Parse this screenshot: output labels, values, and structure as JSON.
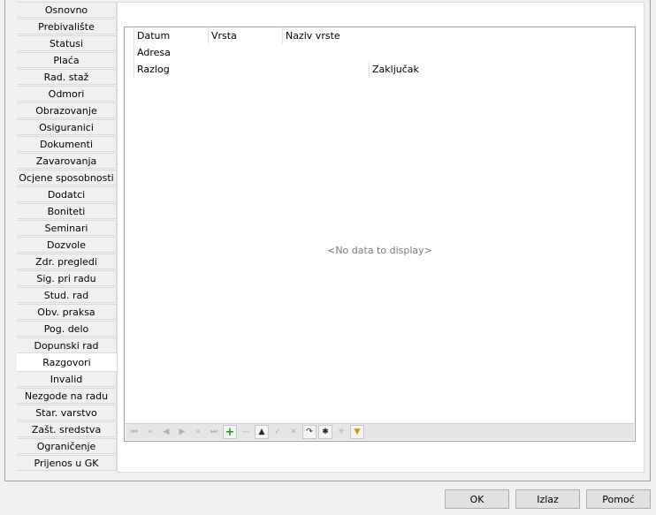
{
  "tabs": [
    {
      "label": "Osnovno"
    },
    {
      "label": "Prebivalište"
    },
    {
      "label": "Statusi"
    },
    {
      "label": "Plaća"
    },
    {
      "label": "Rad. staž"
    },
    {
      "label": "Odmori"
    },
    {
      "label": "Obrazovanje"
    },
    {
      "label": "Osiguranici"
    },
    {
      "label": "Dokumenti"
    },
    {
      "label": "Zavarovanja"
    },
    {
      "label": "Ocjene sposobnosti"
    },
    {
      "label": "Dodatci"
    },
    {
      "label": "Boniteti"
    },
    {
      "label": "Seminari"
    },
    {
      "label": "Dozvole"
    },
    {
      "label": "Zdr. pregledi"
    },
    {
      "label": "Sig. pri radu"
    },
    {
      "label": "Stud. rad"
    },
    {
      "label": "Obv. praksa"
    },
    {
      "label": "Pog. delo"
    },
    {
      "label": "Dopunski rad"
    },
    {
      "label": "Razgovori"
    },
    {
      "label": "Invalid"
    },
    {
      "label": "Nezgode na radu"
    },
    {
      "label": "Star. varstvo"
    },
    {
      "label": "Zašt. sredstva"
    },
    {
      "label": "Ograničenje"
    },
    {
      "label": "Prijenos u GK"
    }
  ],
  "active_tab": "Razgovori",
  "grid": {
    "header_row1": {
      "datum": "Datum",
      "vrsta": "Vrsta",
      "naziv_vrste": "Naziv vrste"
    },
    "header_row2": {
      "adresa": "Adresa"
    },
    "header_row3": {
      "razlog": "Razlog",
      "zakljucak": "Zaključak"
    },
    "empty_text": "<No data to display>"
  },
  "navigator": {
    "icons": [
      "first-icon",
      "prev-page-icon",
      "prev-icon",
      "next-icon",
      "next-page-icon",
      "last-icon",
      "add-icon",
      "delete-icon",
      "edit-icon",
      "post-icon",
      "cancel-icon",
      "refresh-icon",
      "bookmark-icon",
      "goto-bookmark-icon",
      "filter-icon"
    ]
  },
  "buttons": {
    "ok": "OK",
    "exit": "Izlaz",
    "help": "Pomoć"
  }
}
